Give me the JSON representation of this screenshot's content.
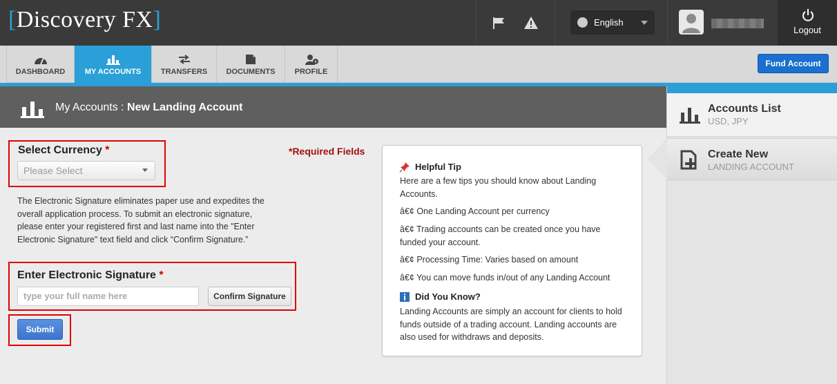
{
  "brand": {
    "name": "Discovery FX",
    "bracket_left": "[",
    "bracket_right": "]",
    "accent": "#2a9fd8"
  },
  "topbar": {
    "language": "English",
    "logout_label": "Logout"
  },
  "nav": {
    "tabs": [
      {
        "label": "DASHBOARD",
        "icon": "dashboard-icon"
      },
      {
        "label": "MY ACCOUNTS",
        "icon": "bar-chart-icon",
        "active": true
      },
      {
        "label": "TRANSFERS",
        "icon": "transfer-arrows-icon"
      },
      {
        "label": "DOCUMENTS",
        "icon": "document-icon"
      },
      {
        "label": "PROFILE",
        "icon": "profile-icon"
      }
    ],
    "fund_account_label": "Fund Account"
  },
  "header": {
    "section": "My Accounts",
    "separator": " : ",
    "page": "New Landing Account"
  },
  "form": {
    "currency_label": "Select Currency",
    "required_mark": "*",
    "currency_placeholder": "Please Select",
    "required_fields_note": "*Required Fields",
    "description": "The Electronic Signature eliminates paper use and expedites the overall application process. To submit an electronic signature, please enter your registered first and last name into the \"Enter Electronic Signature\" text field and click “Confirm Signature.”",
    "signature_label": "Enter Electronic Signature",
    "signature_placeholder": "type your full name here",
    "confirm_label": "Confirm Signature",
    "submit_label": "Submit"
  },
  "tips": {
    "helpful_title": "Helpful Tip",
    "helpful_intro": "Here are a few tips you should know about Landing Accounts.",
    "items": [
      "â€¢ One Landing Account per currency",
      "â€¢ Trading accounts can be created once you have funded your account.",
      "â€¢ Processing Time: Varies based on amount",
      "â€¢ You can move funds in/out of any Landing Account"
    ],
    "know_title": "Did You Know?",
    "know_text": "Landing Accounts are simply an account for clients to hold funds outside of a trading account. Landing accounts are also used for withdraws and deposits."
  },
  "sidebar": {
    "list_title": "Accounts List",
    "list_sub": "USD, JPY",
    "create_title": "Create New",
    "create_sub": "LANDING ACCOUNT"
  }
}
